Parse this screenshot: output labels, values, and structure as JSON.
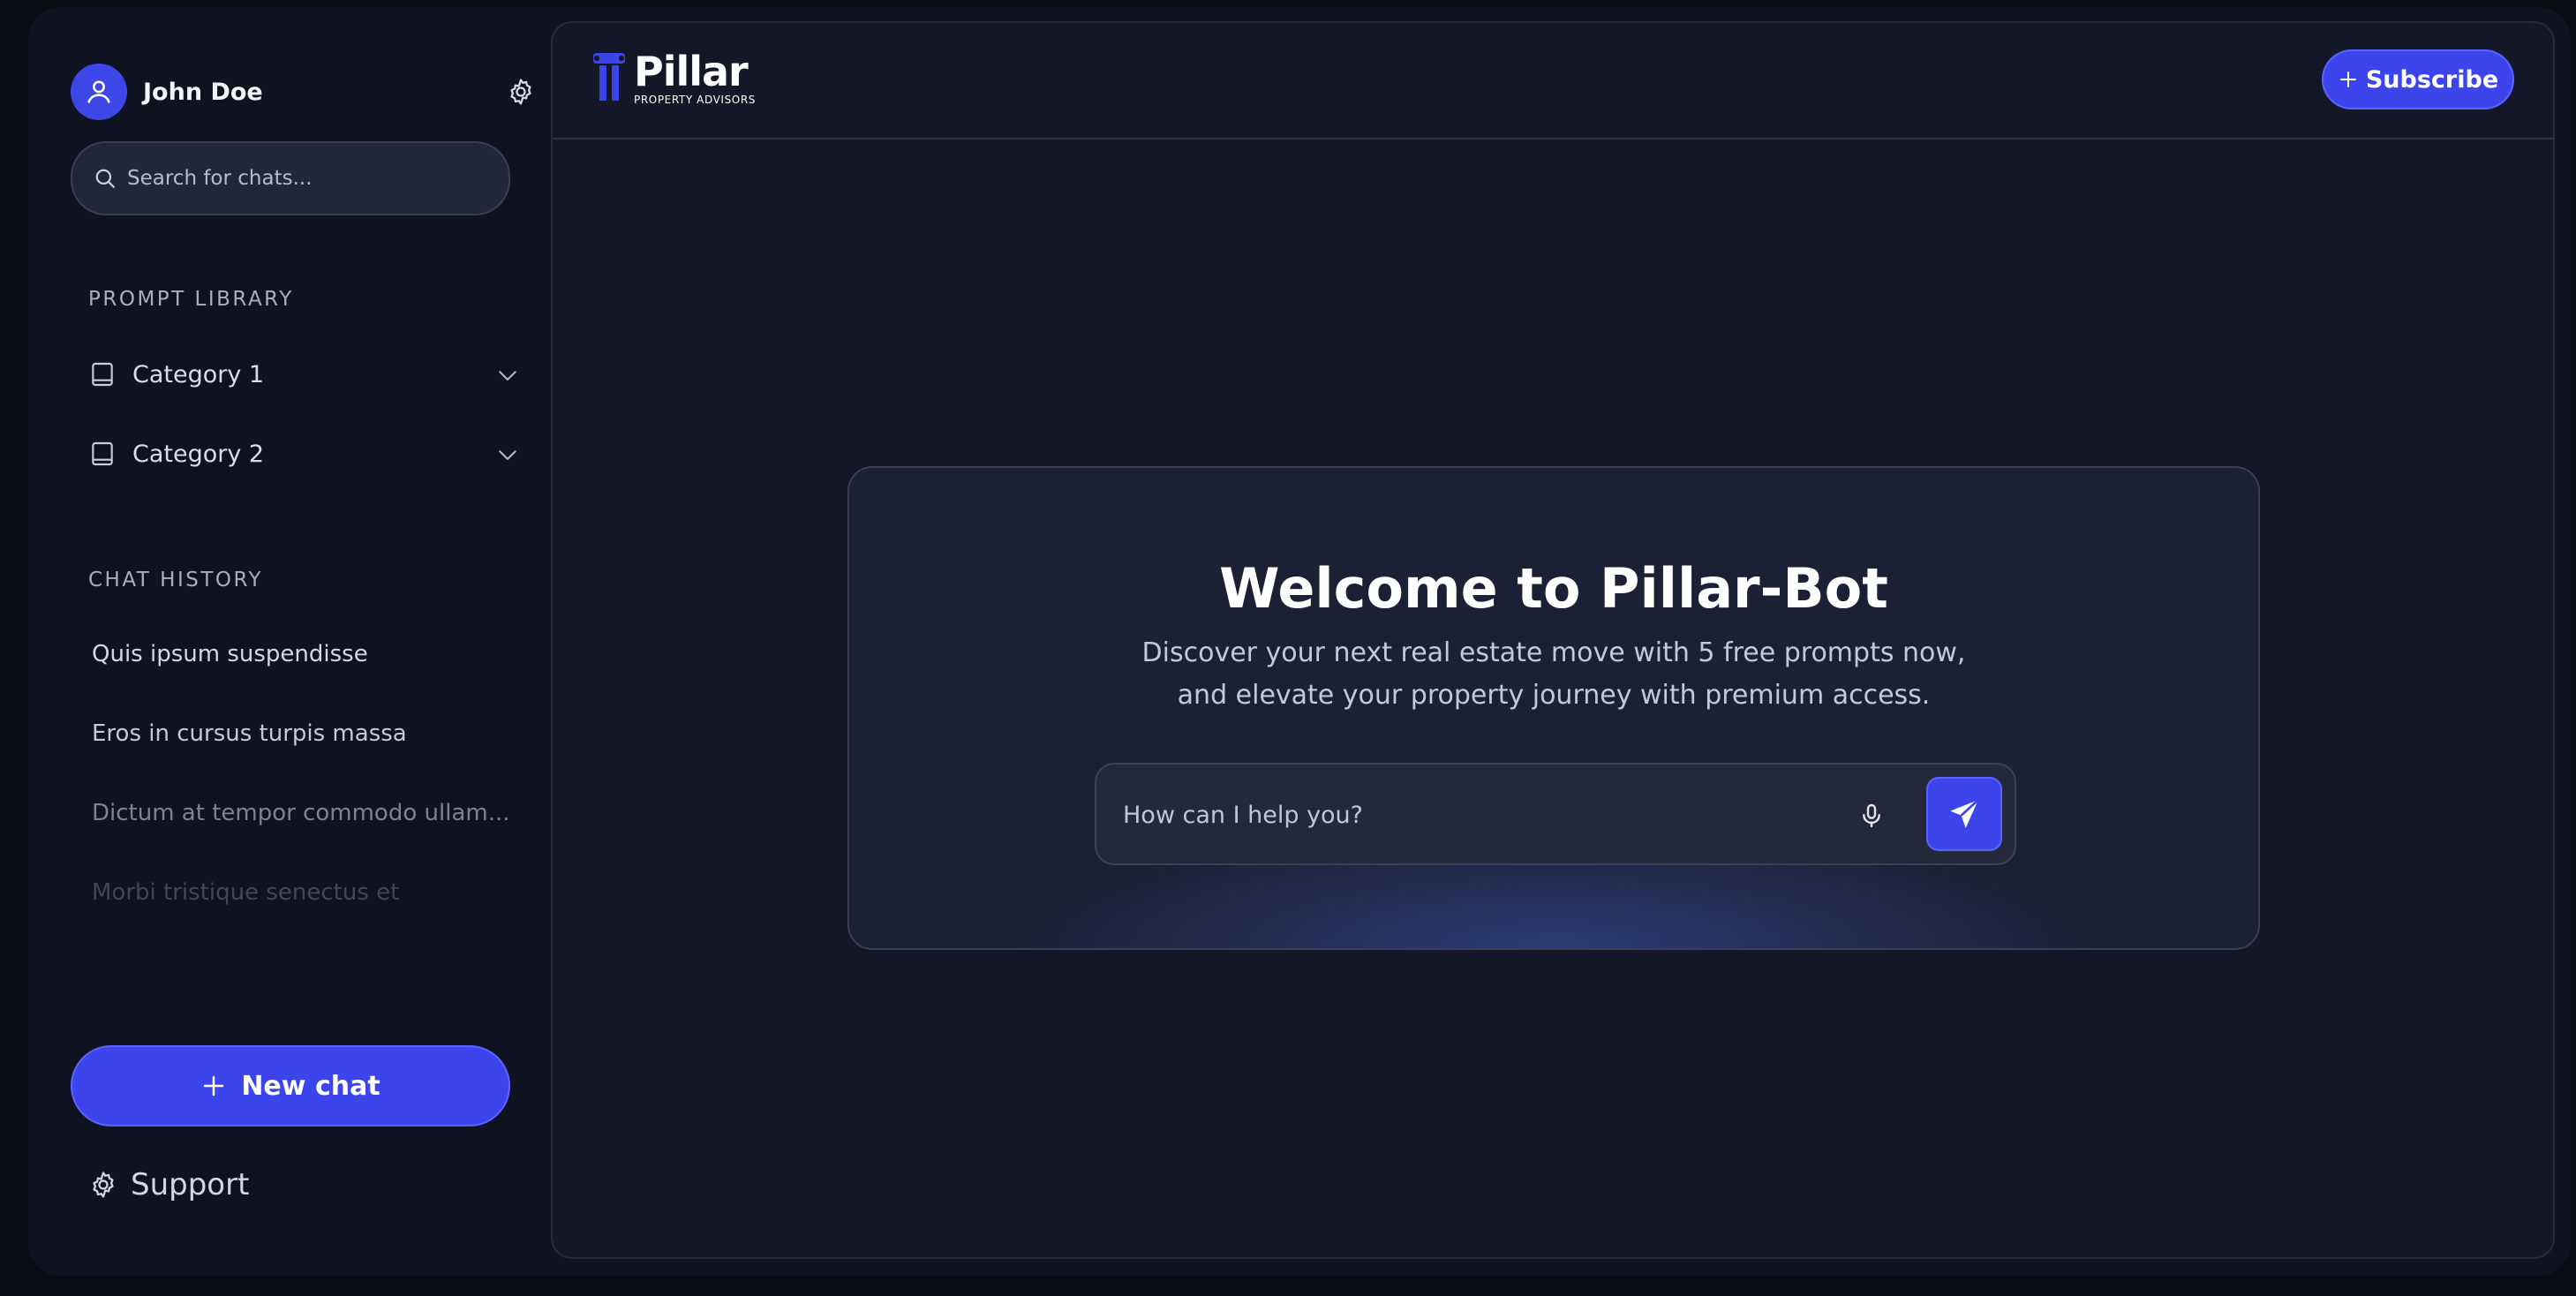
{
  "user": {
    "name": "John Doe"
  },
  "search": {
    "placeholder": "Search for chats..."
  },
  "prompt_library": {
    "title": "PROMPT LIBRARY",
    "categories": [
      {
        "label": "Category 1"
      },
      {
        "label": "Category 2"
      }
    ]
  },
  "chat_history": {
    "title": "CHAT HISTORY",
    "items": [
      {
        "label": "Quis ipsum suspendisse"
      },
      {
        "label": "Eros in cursus turpis massa"
      },
      {
        "label": "Dictum at tempor commodo ullam..."
      },
      {
        "label": "Morbi tristique senectus et"
      }
    ]
  },
  "new_chat": {
    "label": "New chat"
  },
  "support": {
    "label": "Support"
  },
  "header": {
    "logo_name": "Pillar",
    "logo_tagline": "PROPERTY ADVISORS",
    "subscribe_label": "Subscribe"
  },
  "welcome": {
    "title": "Welcome to Pillar-Bot",
    "subtitle_line1": "Discover your next real estate move with 5 free prompts now,",
    "subtitle_line2": "and elevate your property journey with premium access.",
    "input_placeholder": "How can I help you?"
  },
  "colors": {
    "accent": "#3c45ec",
    "background": "#0f1220",
    "panel": "#131728",
    "card": "#1c2034"
  },
  "icons": {
    "avatar": "user-icon",
    "settings": "gear-icon",
    "search": "search-icon",
    "category": "book-icon",
    "expand": "chevron-down-icon",
    "new_chat": "plus-icon",
    "support": "gear-icon",
    "logo": "pillar-column-icon",
    "subscribe": "plus-icon",
    "mic": "microphone-icon",
    "send": "send-icon"
  }
}
